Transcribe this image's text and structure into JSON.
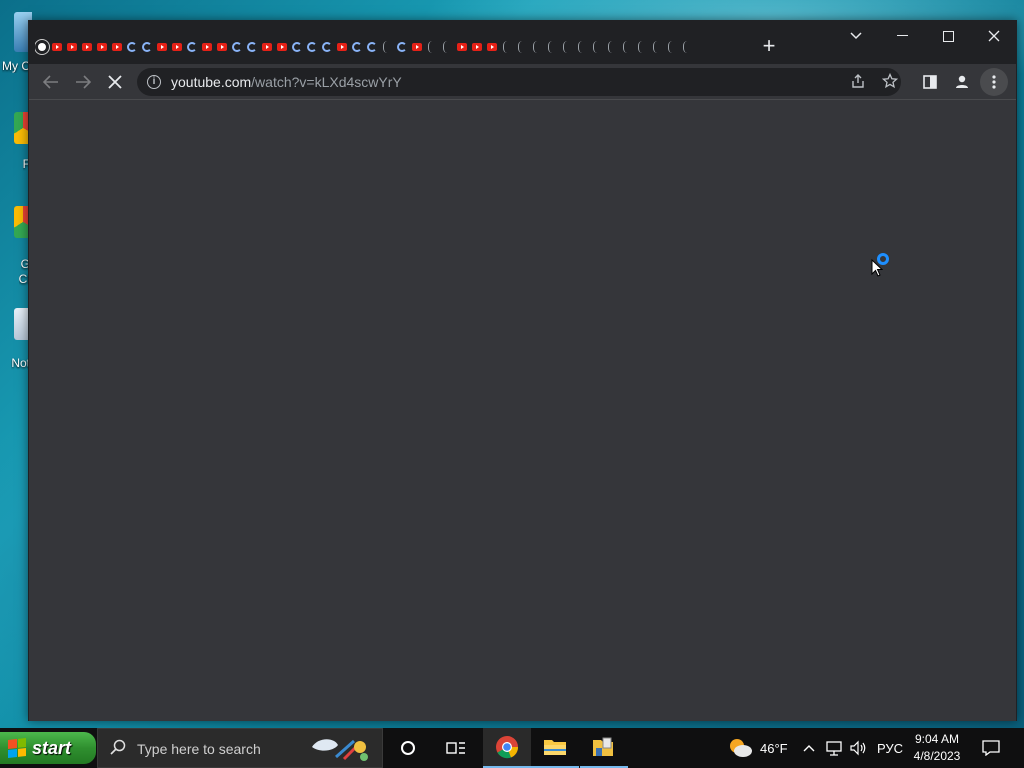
{
  "desktop": {
    "icons": [
      {
        "label": "My C",
        "icon": "my-computer-icon"
      },
      {
        "label": "F",
        "icon": "chrome-shortcut-icon"
      },
      {
        "label": "G",
        "label2": "Cl",
        "icon": "chrome-shortcut-icon"
      },
      {
        "label": "Not",
        "icon": "notepad-shortcut-icon"
      }
    ]
  },
  "browser": {
    "new_tab_symbol": "+",
    "tab_search_symbol": "⌄",
    "window_controls": {
      "minimize": "—",
      "maximize": "☐",
      "close": "✕"
    },
    "nav": {
      "back": "←",
      "forward": "→",
      "stop": "✕"
    },
    "address": {
      "host": "youtube.com",
      "path": "/watch?v=kLXd4scwYrY",
      "info_symbol": "i"
    },
    "toolbar_icons": [
      "share-icon",
      "bookmark-star-icon",
      "side-panel-icon",
      "profile-icon",
      "menu-icon"
    ]
  },
  "taskbar": {
    "start_label": "start",
    "search_placeholder": "Type here to search",
    "weather": {
      "temp": "46°F"
    },
    "language": "РУС",
    "time": "9:04 AM",
    "date": "4/8/2023"
  },
  "colors": {
    "window_bg": "#35363a",
    "titlebar": "#202124",
    "omnibox": "#202124",
    "taskbar": "#0f0f10",
    "youtube_red": "#e62117",
    "loading_blue": "#1e8fff"
  }
}
